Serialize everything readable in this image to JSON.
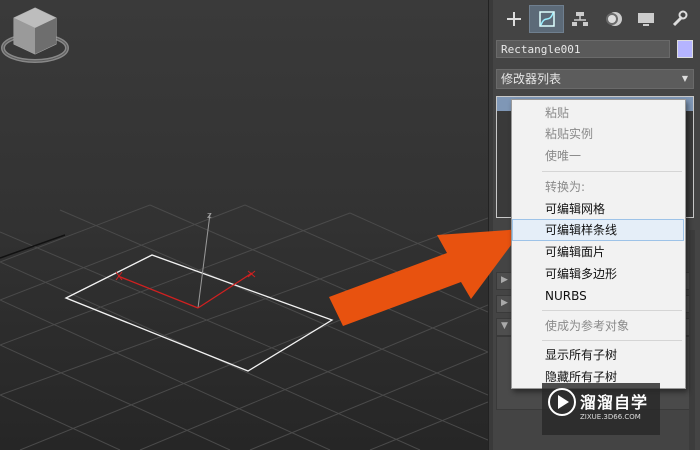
{
  "viewport": {
    "axis_label": "z"
  },
  "panel": {
    "tabs": [
      {
        "name": "create",
        "icon": "plus-icon"
      },
      {
        "name": "modify",
        "icon": "modify-icon"
      },
      {
        "name": "hierarchy",
        "icon": "hierarchy-icon"
      },
      {
        "name": "motion",
        "icon": "motion-icon"
      },
      {
        "name": "display",
        "icon": "display-icon"
      },
      {
        "name": "utilities",
        "icon": "wrench-icon"
      }
    ],
    "active_tab": "modify",
    "object_name": "Rectangle001",
    "object_color": "#b5b4ff",
    "modifier_list": "修改器列表"
  },
  "context_menu": {
    "items": [
      {
        "label": "粘贴",
        "state": "disabled"
      },
      {
        "label": "粘贴实例",
        "state": "disabled"
      },
      {
        "label": "使唯一",
        "state": "disabled"
      },
      {
        "label": "转换为:",
        "state": "disabled"
      },
      {
        "label": "可编辑网格",
        "state": "enabled"
      },
      {
        "label": "可编辑样条线",
        "state": "hover"
      },
      {
        "label": "可编辑面片",
        "state": "enabled"
      },
      {
        "label": "可编辑多边形",
        "state": "enabled"
      },
      {
        "label": "NURBS",
        "state": "enabled"
      },
      {
        "label": "使成为参考对象",
        "state": "disabled"
      },
      {
        "label": "显示所有子树",
        "state": "enabled"
      },
      {
        "label": "隐藏所有子树",
        "state": "enabled"
      }
    ]
  },
  "watermark": {
    "brand": "溜溜自学",
    "url": "ZIXUE.3D66.COM"
  },
  "colors": {
    "arrow": "#e8520f",
    "accent": "#7f97b6"
  }
}
